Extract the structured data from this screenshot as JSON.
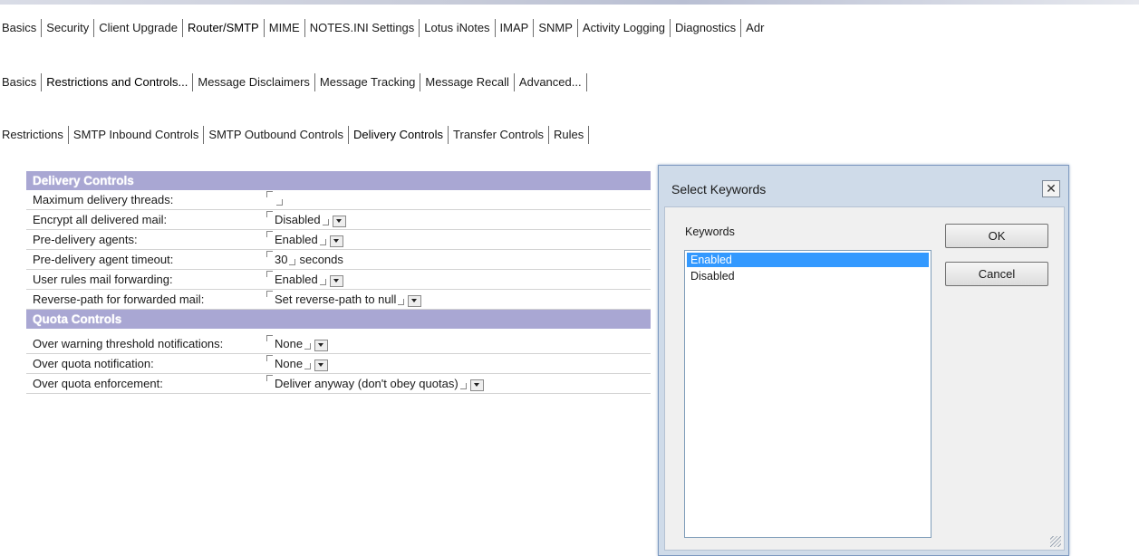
{
  "tabs_level1": [
    "Basics",
    "Security",
    "Client Upgrade",
    "Router/SMTP",
    "MIME",
    "NOTES.INI Settings",
    "Lotus iNotes",
    "IMAP",
    "SNMP",
    "Activity Logging",
    "Diagnostics",
    "Adr"
  ],
  "tabs_level2": [
    "Basics",
    "Restrictions and Controls...",
    "Message Disclaimers",
    "Message Tracking",
    "Message Recall",
    "Advanced..."
  ],
  "tabs_level3": [
    "Restrictions",
    "SMTP Inbound Controls",
    "SMTP Outbound Controls",
    "Delivery Controls",
    "Transfer Controls",
    "Rules"
  ],
  "delivery": {
    "heading": "Delivery Controls",
    "max_threads": {
      "label": "Maximum delivery threads:",
      "value": ""
    },
    "encrypt": {
      "label": "Encrypt all delivered mail:",
      "value": "Disabled"
    },
    "agents": {
      "label": "Pre-delivery agents:",
      "value": "Enabled"
    },
    "timeout": {
      "label": "Pre-delivery agent timeout:",
      "value": "30",
      "unit": "seconds"
    },
    "forwarding": {
      "label": "User rules mail forwarding:",
      "value": "Enabled"
    },
    "reverse_path": {
      "label": "Reverse-path for forwarded mail:",
      "value": "Set reverse-path to null"
    }
  },
  "quota": {
    "heading": "Quota Controls",
    "warning": {
      "label": "Over warning threshold notifications:",
      "value": "None"
    },
    "notification": {
      "label": "Over quota notification:",
      "value": "None"
    },
    "enforcement": {
      "label": "Over quota enforcement:",
      "value": "Deliver anyway (don't obey quotas)"
    }
  },
  "dialog": {
    "title": "Select Keywords",
    "close": "✕",
    "keywords_label": "Keywords",
    "options": [
      "Enabled",
      "Disabled"
    ],
    "ok": "OK",
    "cancel": "Cancel"
  }
}
